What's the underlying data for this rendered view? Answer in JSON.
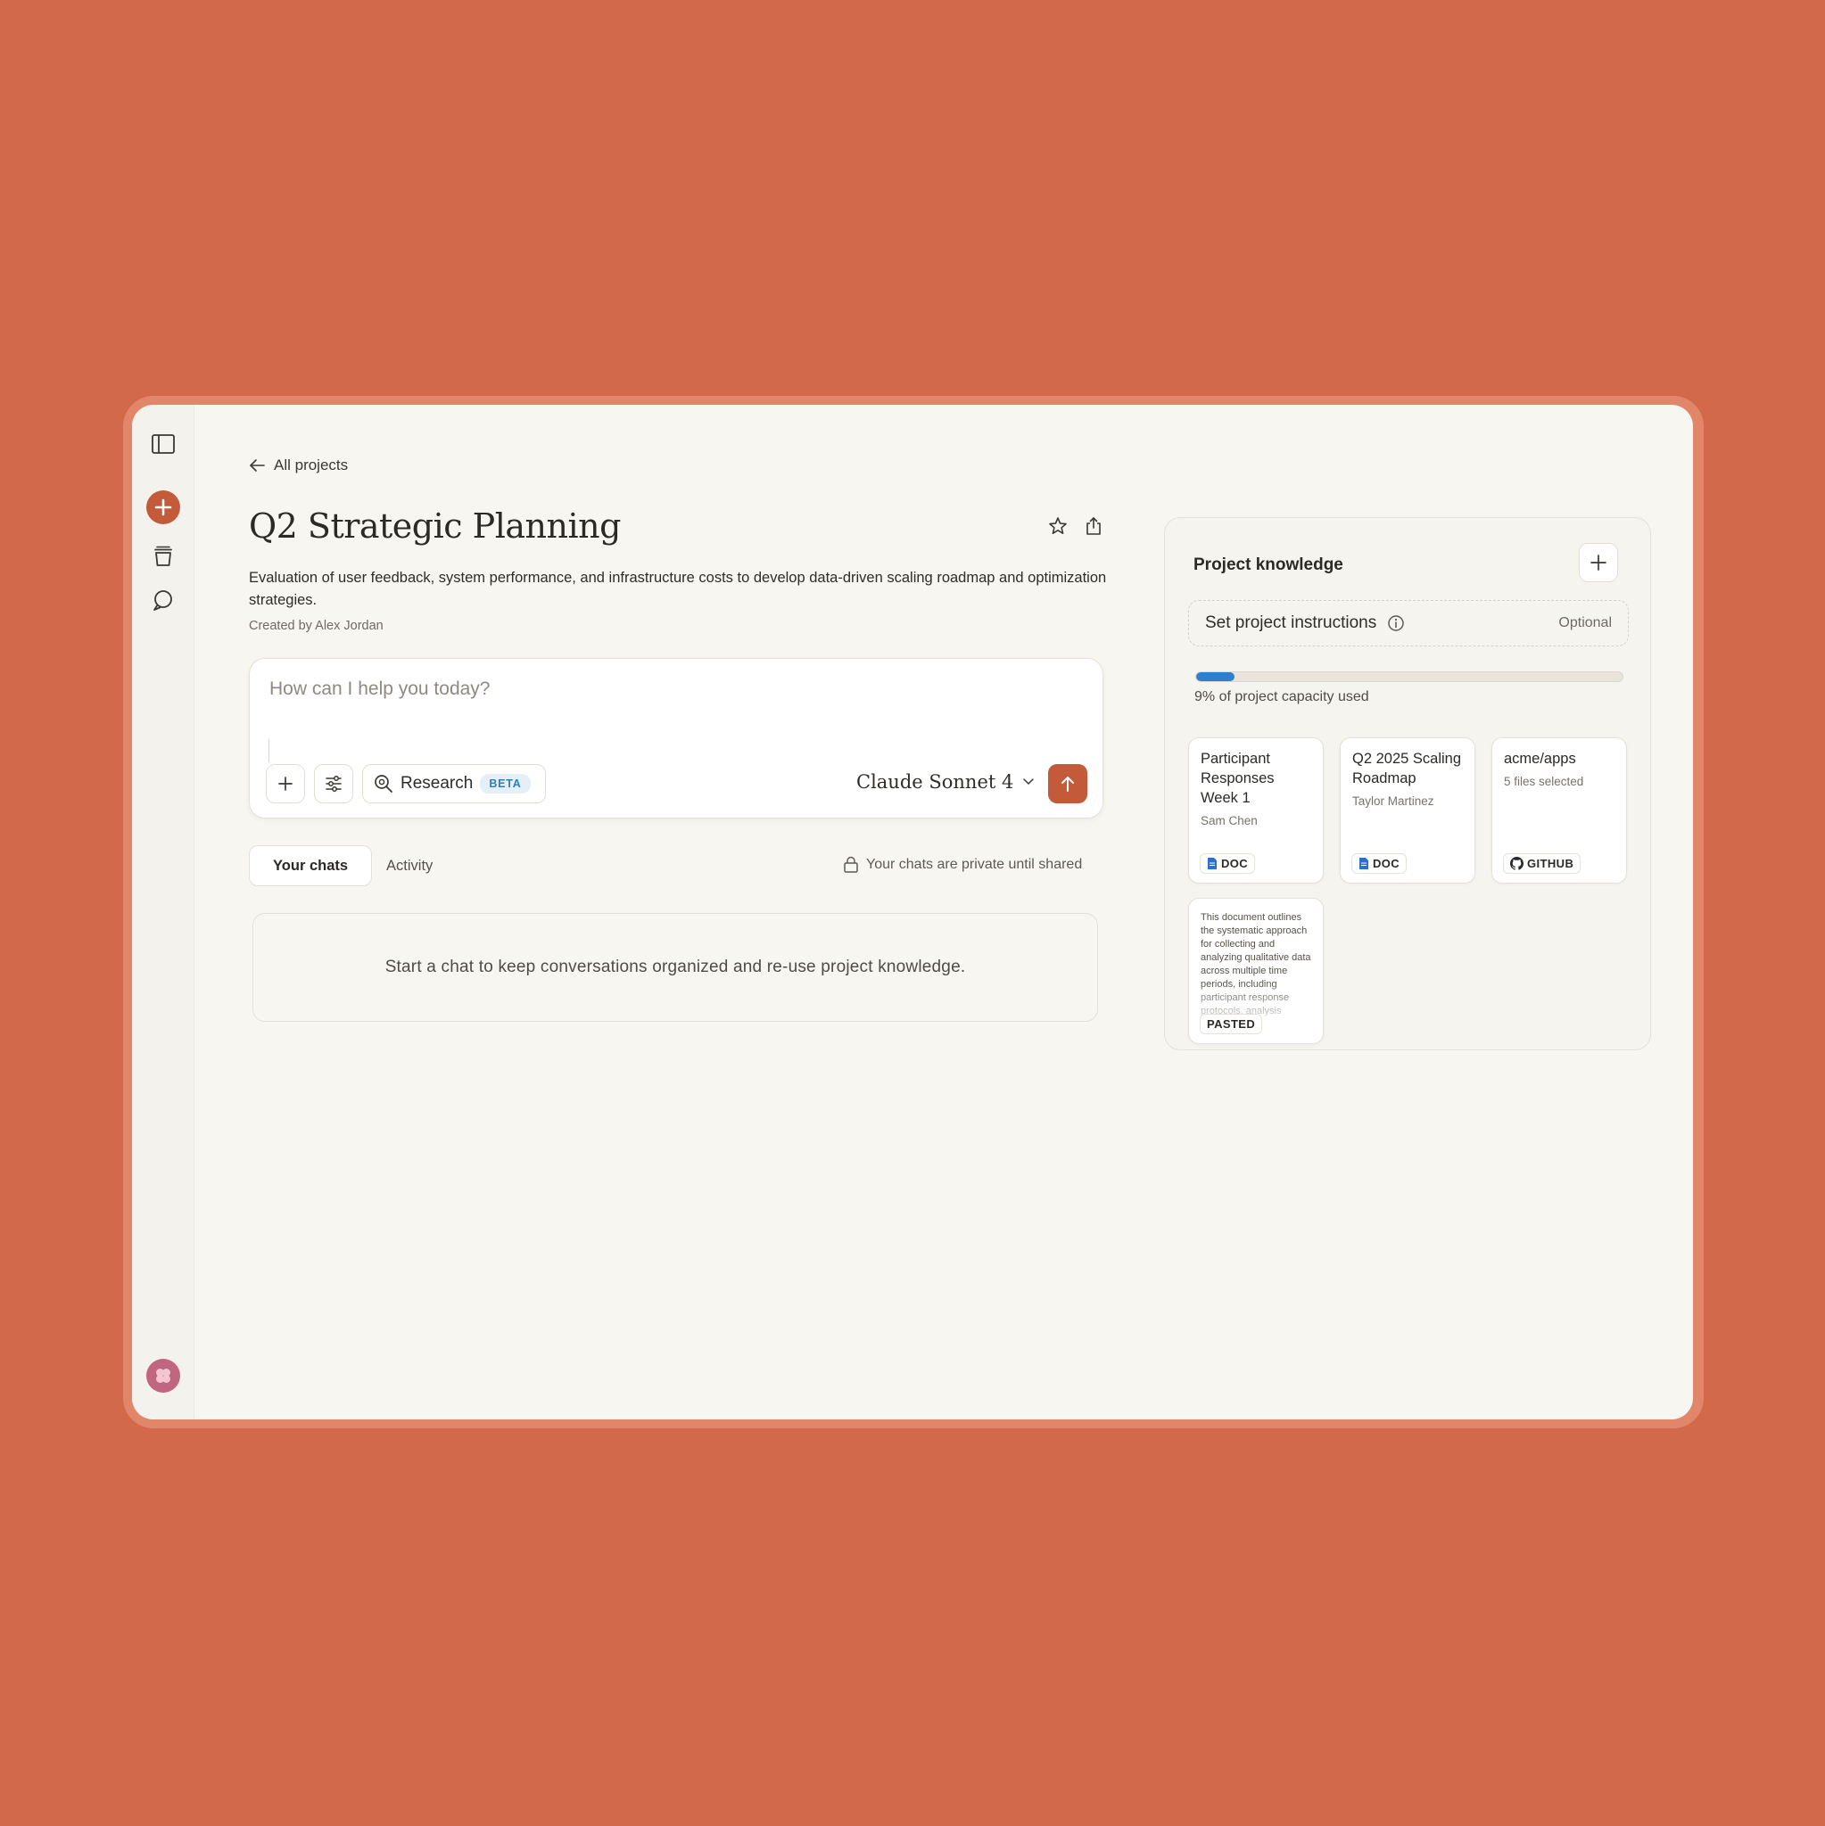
{
  "nav": {
    "back_label": "All projects"
  },
  "project": {
    "title": "Q2 Strategic Planning",
    "description": "Evaluation of user feedback, system performance, and infrastructure costs to develop data-driven scaling roadmap and optimization strategies.",
    "creator": "Created by Alex Jordan"
  },
  "composer": {
    "placeholder": "How can I help you today?",
    "research_label": "Research",
    "beta_label": "BETA",
    "model_label": "Claude Sonnet 4"
  },
  "chats": {
    "tabs": [
      "Your chats",
      "Activity"
    ],
    "privacy_note": "Your chats are private until shared",
    "empty_message": "Start a chat to keep conversations organized and re-use project knowledge."
  },
  "knowledge": {
    "title": "Project knowledge",
    "instructions_label": "Set project instructions",
    "instructions_optional": "Optional",
    "capacity_percent": 9,
    "capacity_text": "9% of project capacity used",
    "files": [
      {
        "title": "Participant Responses Week 1",
        "subtitle": "Sam Chen",
        "badge": "DOC"
      },
      {
        "title": "Q2 2025 Scaling Roadmap",
        "subtitle": "Taylor Martinez",
        "badge": "DOC"
      },
      {
        "title": "acme/apps",
        "subtitle": "5 files selected",
        "badge": "GITHUB"
      }
    ],
    "pasted": {
      "preview": "This document outlines the systematic approach for collecting and analyzing qualitative data across multiple time periods, including participant response protocols, analysis",
      "badge": "PASTED"
    }
  },
  "colors": {
    "background": "#d2694b",
    "accent": "#c35a3a",
    "capacity_bar": "#2f7fcc",
    "doc_icon": "#2a6fd6"
  },
  "icons": [
    "sidebar-toggle-icon",
    "plus-icon",
    "projects-icon",
    "chats-icon",
    "avatar-icon",
    "arrow-left-icon",
    "star-icon",
    "share-icon",
    "sliders-icon",
    "research-icon",
    "chevron-down-icon",
    "arrow-up-icon",
    "lock-icon",
    "info-icon",
    "doc-icon",
    "github-icon"
  ]
}
